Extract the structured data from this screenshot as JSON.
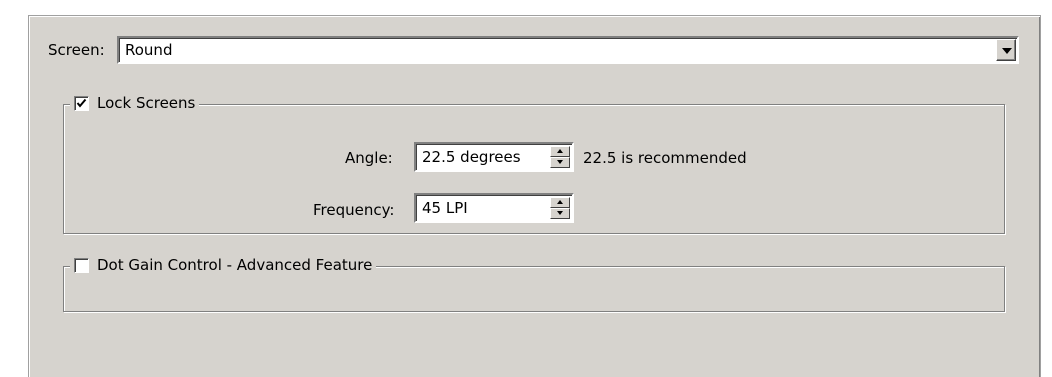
{
  "screen": {
    "label": "Screen:",
    "value": "Round"
  },
  "lock_screens": {
    "label": "Lock Screens",
    "checked": true,
    "angle": {
      "label": "Angle:",
      "value": "22.5 degrees",
      "hint": "22.5 is recommended"
    },
    "frequency": {
      "label": "Frequency:",
      "value": "45 LPI"
    }
  },
  "dot_gain": {
    "label": "Dot Gain Control - Advanced Feature",
    "checked": false
  },
  "colors": {
    "panel_bg": "#d6d3ce",
    "input_bg": "#ffffff",
    "border_dark": "#808080"
  },
  "icons": {
    "dropdown": "chevron-down-icon",
    "spin_up": "arrow-up-icon",
    "spin_down": "arrow-down-icon",
    "checkmark": "checkmark-icon"
  }
}
